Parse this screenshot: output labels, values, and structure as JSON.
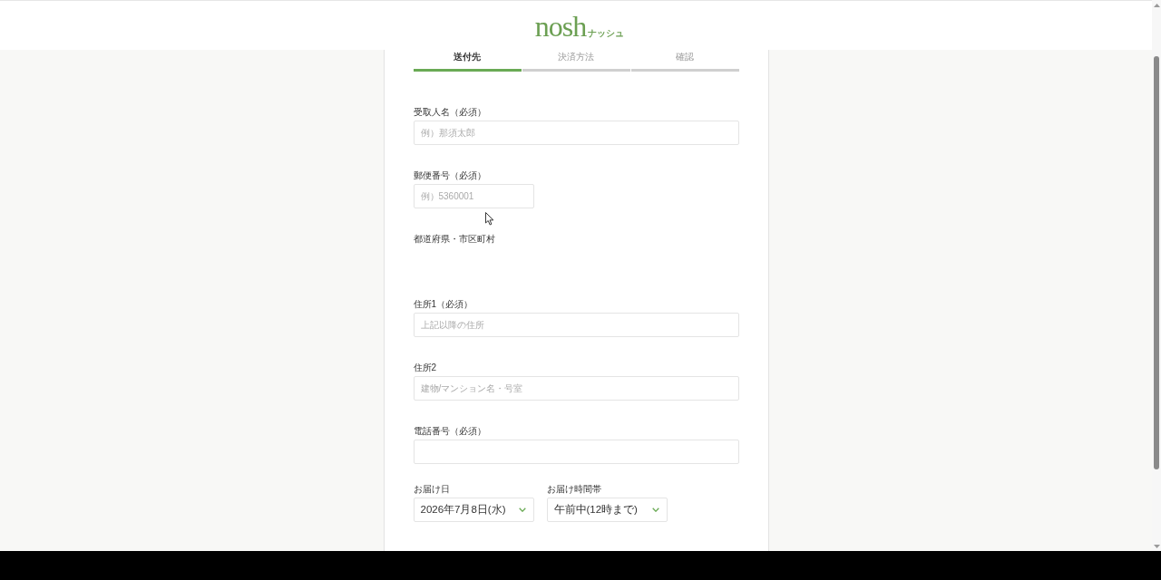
{
  "header": {
    "logo": "nosh",
    "logo_kana": "ナッシュ"
  },
  "steps": [
    {
      "label": "送付先",
      "selected": true
    },
    {
      "label": "決済方法",
      "selected": false
    },
    {
      "label": "確認",
      "selected": false
    }
  ],
  "fields": [
    {
      "kind": "input",
      "label": "受取人名（必須）",
      "placeholder": "例）那須太郎"
    },
    {
      "kind": "short_input",
      "label": "郵便番号（必須）",
      "placeholder": "例）5360001"
    },
    {
      "kind": "display",
      "label": "都道府県・市区町村"
    },
    {
      "kind": "input",
      "label": "住所1（必須）",
      "placeholder": "上記以降の住所"
    },
    {
      "kind": "input",
      "label": "住所2",
      "placeholder": "建物/マンション名・号室"
    },
    {
      "kind": "input",
      "label": "電話番号（必須）"
    }
  ],
  "delivery": [
    {
      "label": "お届け日",
      "value": "2026年7月8日(水)"
    },
    {
      "label": "お届け時間帯",
      "value": "午前中(12時まで)"
    }
  ]
}
